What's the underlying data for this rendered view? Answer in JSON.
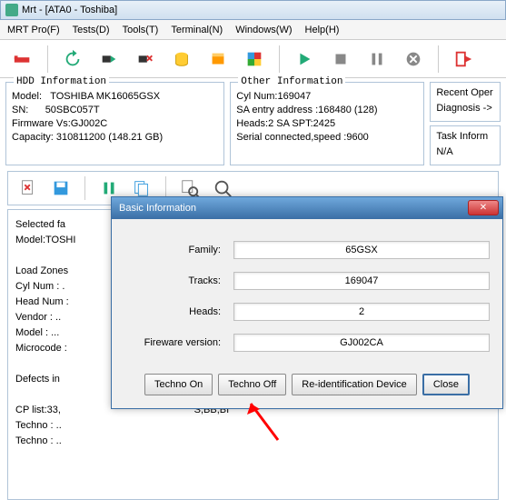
{
  "window": {
    "title": "Mrt - [ATA0 - Toshiba]"
  },
  "menu": {
    "mrtpro": "MRT Pro(F)",
    "tests": "Tests(D)",
    "tools": "Tools(T)",
    "terminal": "Terminal(N)",
    "windows": "Windows(W)",
    "help": "Help(H)"
  },
  "hdd": {
    "title": "HDD Information",
    "model_k": "Model:",
    "model_v": "TOSHIBA MK16065GSX",
    "sn_k": "SN:",
    "sn_v": "50SBC057T",
    "fw_k": "Firmware Vs:",
    "fw_v": "GJ002C",
    "cap_k": "Capacity:",
    "cap_v": "310811200 (148.21 GB)"
  },
  "other": {
    "title": "Other Information",
    "l1": "Cyl Num:169047",
    "l2": "SA entry address :168480 (128)",
    "l3": "Heads:2 SA SPT:2425",
    "l4": "Serial connected,speed :9600"
  },
  "side": {
    "recent_t": "Recent Oper",
    "recent_v": "Diagnosis ->",
    "task_t": "Task Inform",
    "task_v": "N/A"
  },
  "log": {
    "l1": "Selected fa",
    "l2": "Model:TOSHI",
    "l3": "",
    "l4": "Load Zones ",
    "l5": "Cyl Num : .",
    "l6": "Head Num : ",
    "l7": "Vendor : ..",
    "l8": "Model : ...",
    "l9": "Microcode :",
    "l10": "",
    "l11": "Defects in ",
    "l12": "",
    "l13": "CP list:33,                                                S,BB,BI",
    "l14": "Techno : ..",
    "l15": "Techno : .."
  },
  "dialog": {
    "title": "Basic Information",
    "family_k": "Family:",
    "family_v": "65GSX",
    "tracks_k": "Tracks:",
    "tracks_v": "169047",
    "heads_k": "Heads:",
    "heads_v": "2",
    "fw_k": "Fireware version:",
    "fw_v": "GJ002CA",
    "btn_on": "Techno On",
    "btn_off": "Techno Off",
    "btn_reid": "Re-identification Device",
    "btn_close": "Close"
  }
}
